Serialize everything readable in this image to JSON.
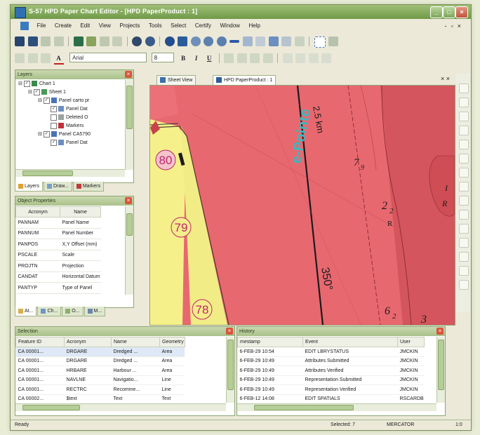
{
  "window": {
    "title": "S-57 HPD Paper Chart Editor - [HPD PaperProduct : 1]"
  },
  "menu": {
    "items": [
      "File",
      "Create",
      "Edit",
      "View",
      "Projects",
      "Tools",
      "Select",
      "Certify",
      "Window",
      "Help"
    ]
  },
  "format_toolbar": {
    "font": "Arial",
    "size": "8"
  },
  "layers_panel": {
    "title": "Layers",
    "tree": [
      {
        "label": "Chart 1",
        "depth": 0
      },
      {
        "label": "Sheet 1",
        "depth": 1
      },
      {
        "label": "Panel carto pr",
        "depth": 2
      },
      {
        "label": "Panel Dat",
        "depth": 3
      },
      {
        "label": "Deleted O",
        "depth": 3
      },
      {
        "label": "Markers",
        "depth": 3
      },
      {
        "label": "Panel CA5790",
        "depth": 2
      },
      {
        "label": "Panel Dat",
        "depth": 3
      }
    ],
    "tabs": [
      "Layers",
      "Draw...",
      "Markers"
    ]
  },
  "properties_panel": {
    "title": "Object Properties",
    "columns": [
      "Acronym",
      "Name"
    ],
    "rows": [
      [
        "PANNAM",
        "Panel Name"
      ],
      [
        "PANNUM",
        "Panel Number"
      ],
      [
        "PANPOS",
        "X,Y Offset (mm)"
      ],
      [
        "PSCALE",
        "Scale"
      ],
      [
        "PROJTN",
        "Projection"
      ],
      [
        "CANDAT",
        "Horizontal Datum"
      ],
      [
        "PANTYP",
        "Type of Panel"
      ]
    ],
    "tabs": [
      "At...",
      "Ch...",
      "O...",
      "M..."
    ]
  },
  "doc_tabs": {
    "tab1": "Sheet View",
    "tab2": "HPD PaperProduct : 1",
    "close": "× ×"
  },
  "map": {
    "labels": {
      "depth_80": "80",
      "depth_79": "79",
      "depth_78": "78",
      "place": "e-Pointe",
      "dist": "2.5 km",
      "bearing": "350°",
      "d_79": "7",
      "d_79_sub": "9",
      "d_22": "2",
      "d_22_sub": "2",
      "r_letter": "R",
      "ir": "I",
      "r2": "R",
      "d_62": "6",
      "d_62_sub": "2",
      "d_3": "3"
    }
  },
  "features_panel": {
    "title": "Selection",
    "columns": [
      "Feature ID",
      "Acronym",
      "Name",
      "Geometry"
    ],
    "rows": [
      [
        "CA 00001...",
        "DRGARE",
        "Dredged ...",
        "Area"
      ],
      [
        "CA 00001...",
        "DRGARE",
        "Dredged ...",
        "Area"
      ],
      [
        "CA 00001...",
        "HRBARE",
        "Harbour ...",
        "Area"
      ],
      [
        "CA 00001...",
        "NAVLNE",
        "Navigatio...",
        "Line"
      ],
      [
        "CA 00001...",
        "RECTRC",
        "Recomme...",
        "Line"
      ],
      [
        "CA 00002...",
        "$text",
        "Text",
        "Text"
      ]
    ]
  },
  "history_panel": {
    "title": "History",
    "columns": [
      "mestamp",
      "Event",
      "User"
    ],
    "rows": [
      [
        "6-FEB-29 10:54",
        "EDIT LBRYSTATUS",
        "JMCKIN"
      ],
      [
        "6-FEB-29 10:49",
        "Attributes Submitted",
        "JMCKIN"
      ],
      [
        "6-FEB-29 10:49",
        "Attributes Verified",
        "JMCKIN"
      ],
      [
        "6-FEB-29 10:49",
        "Representation Submitted",
        "JMCKIN"
      ],
      [
        "6-FEB-29 10:49",
        "Representation Verified",
        "JMCKIN"
      ],
      [
        "6-FEB-12 14:08",
        "EDIT SPATIALS",
        "RSCARDB"
      ]
    ]
  },
  "status": {
    "left": "Ready",
    "selected": "Selected: 7",
    "projection": "MERCATOR",
    "scale": "1:0"
  },
  "colors": {
    "map_red": "#e6646b",
    "map_dark_red": "#d4555d",
    "map_yellow": "#f5f08a",
    "label_teal": "#3bb8c0",
    "label_magenta": "#c0266d"
  }
}
